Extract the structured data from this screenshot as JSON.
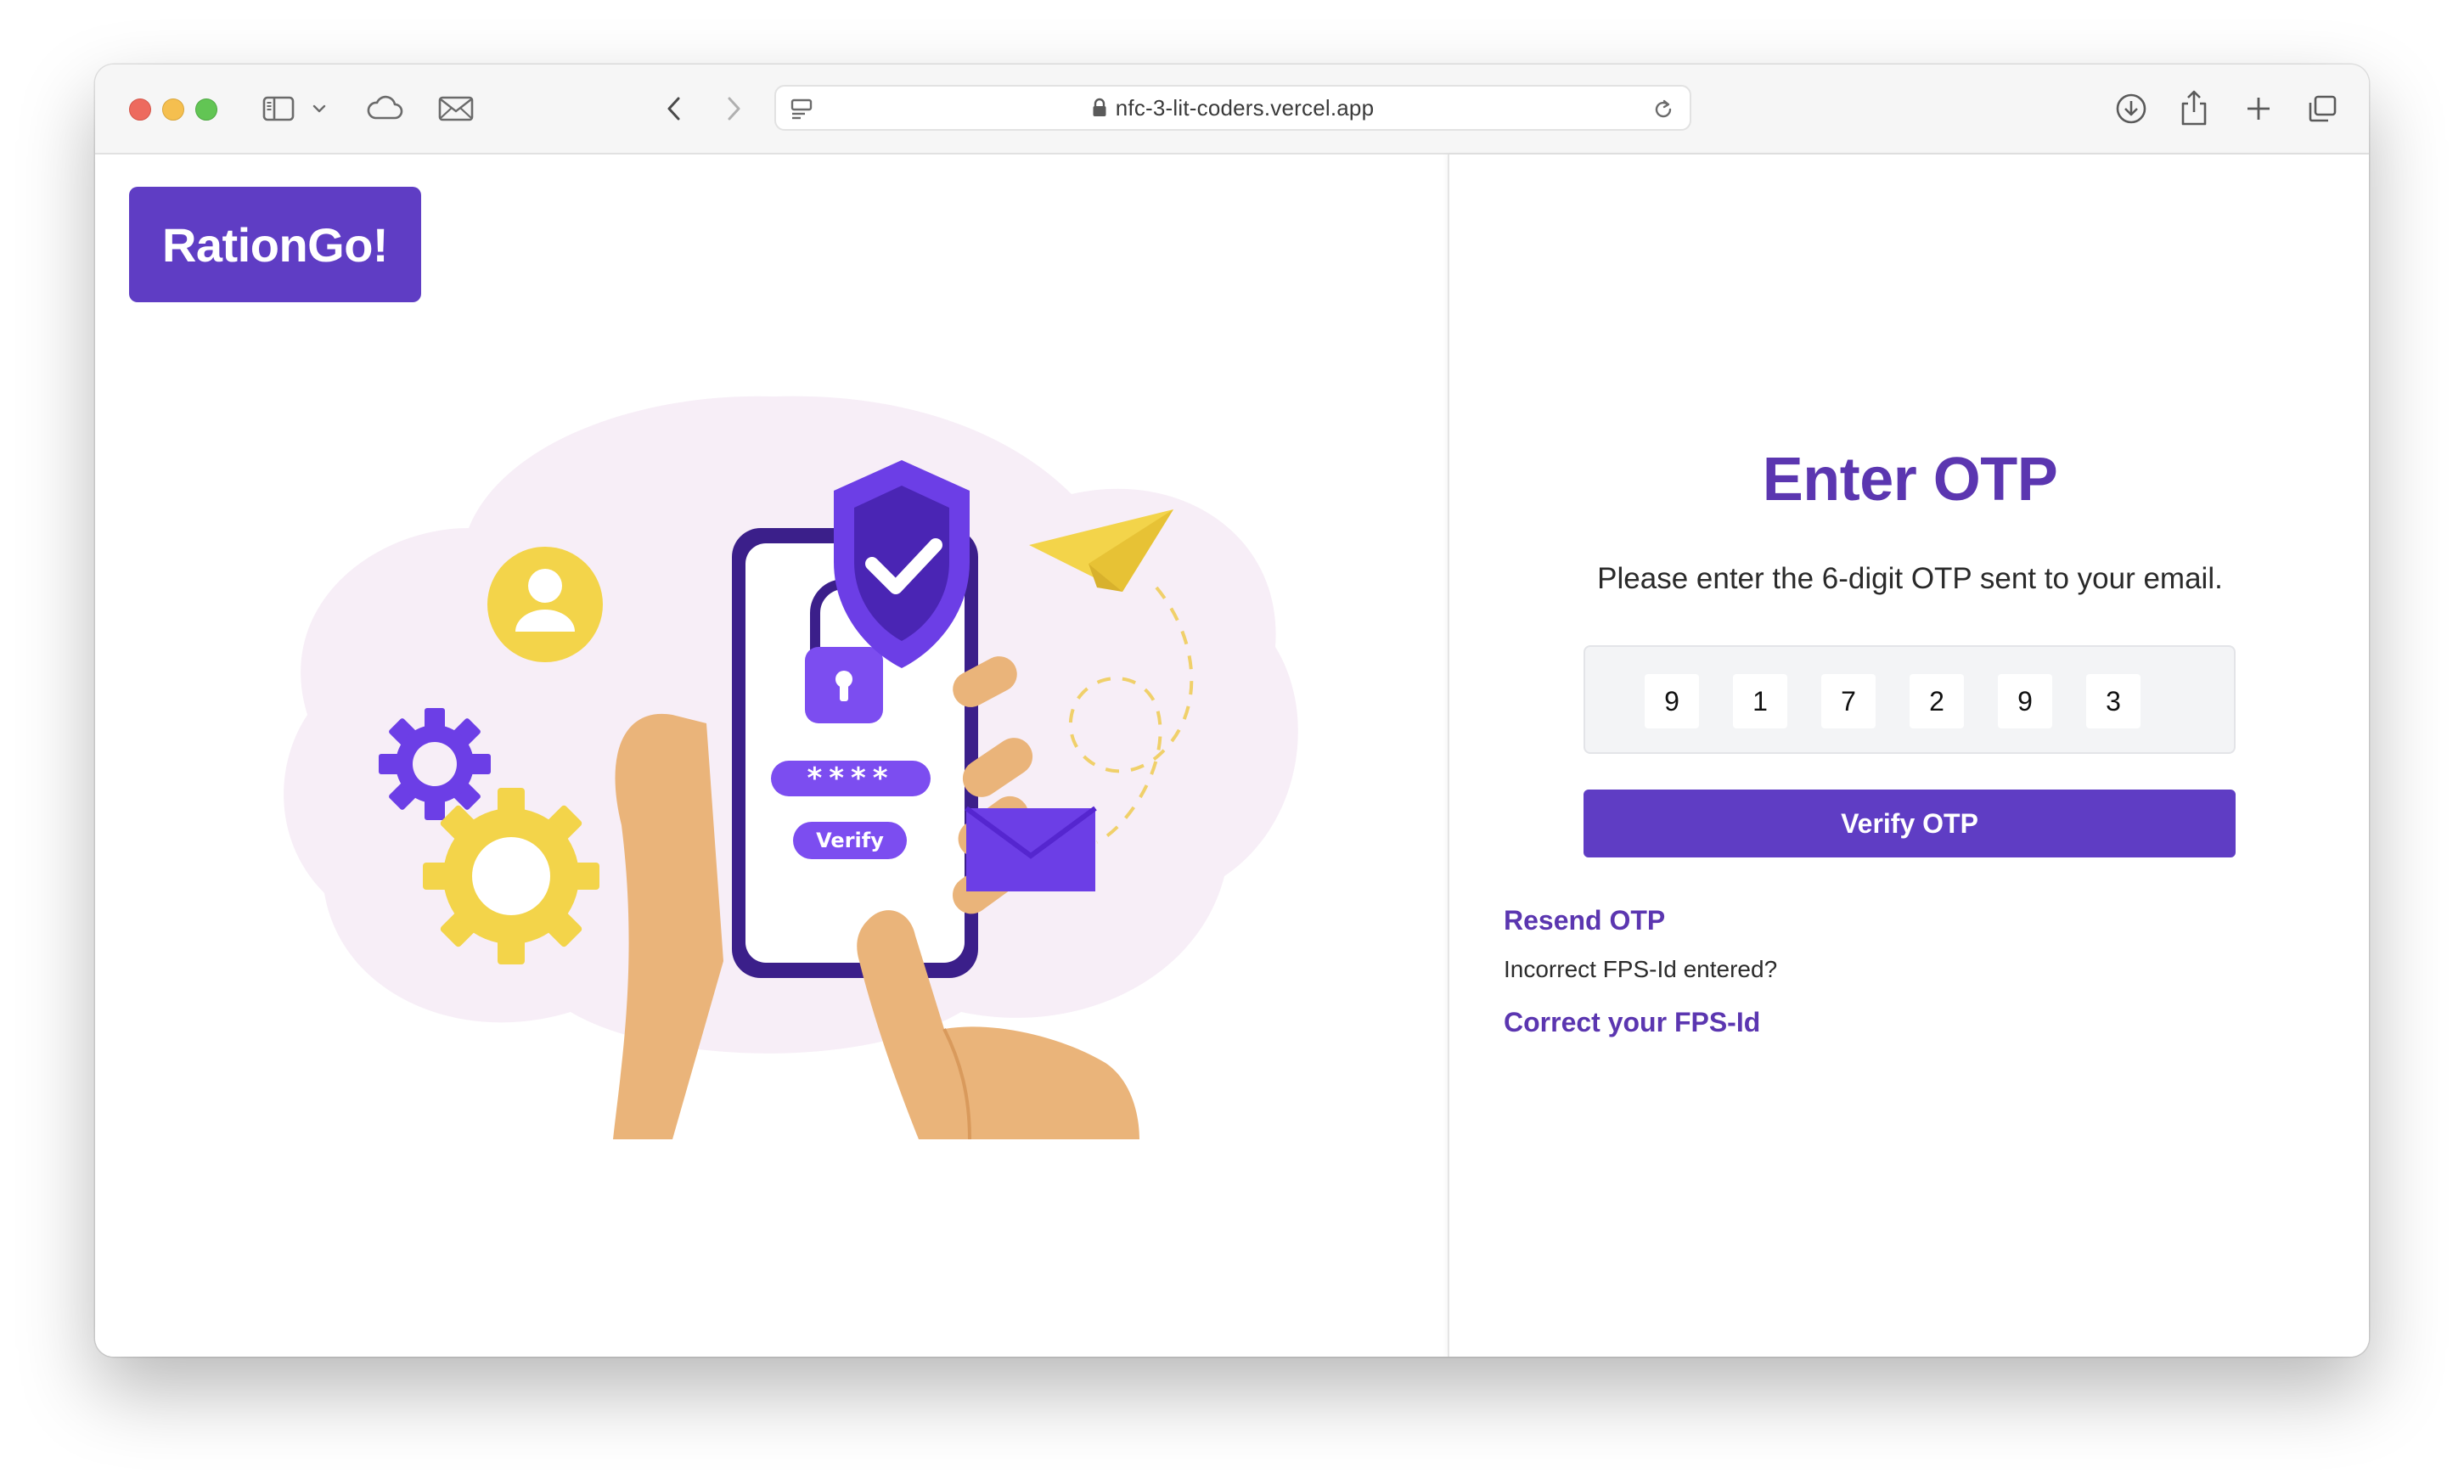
{
  "browser": {
    "url": "nfc-3-lit-coders.vercel.app"
  },
  "brand": {
    "name": "RationGo!"
  },
  "illustration": {
    "phone_button_label": "Verify",
    "password_mask": "****"
  },
  "otp": {
    "title": "Enter OTP",
    "subtitle": "Please enter the 6-digit OTP sent to your email.",
    "digits": [
      "9",
      "1",
      "7",
      "2",
      "9",
      "3"
    ],
    "verify_label": "Verify OTP",
    "resend_label": "Resend OTP",
    "incorrect_text": "Incorrect FPS-Id entered?",
    "correct_label": "Correct your FPS-Id"
  },
  "colors": {
    "accent": "#5f3dc4",
    "accent_text": "#5b36b0",
    "otp_box_bg": "#f3f4f6"
  }
}
